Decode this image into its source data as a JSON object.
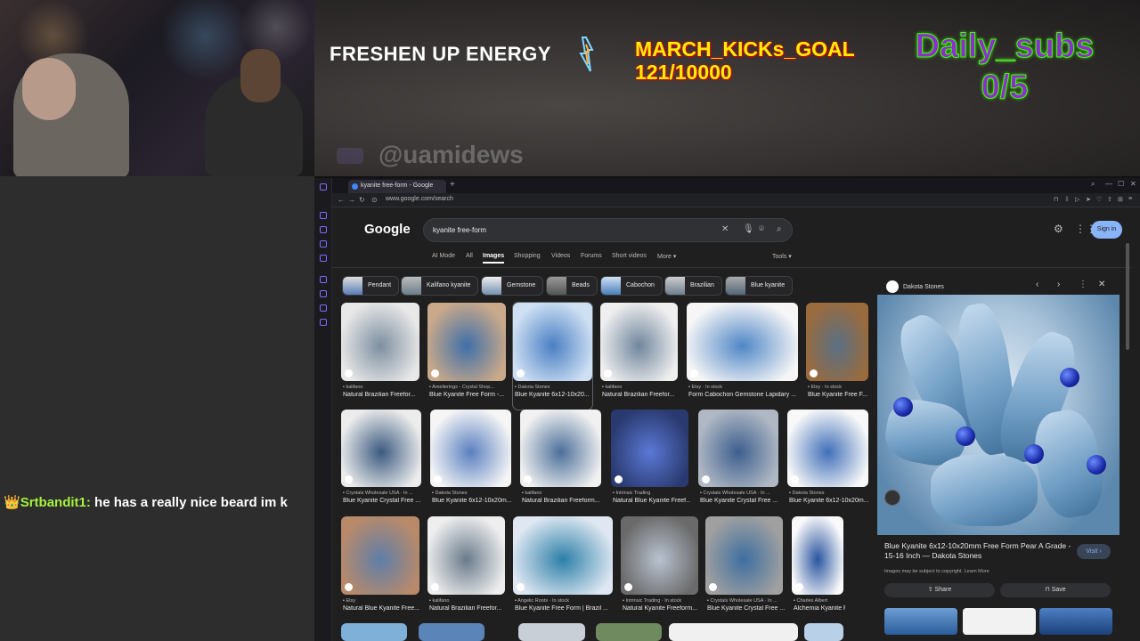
{
  "overlay": {
    "freshen_text": "FRESHEN UP ENERGY",
    "goal_title": "MARCH_KICKs_GOAL",
    "goal_value": "121/10000",
    "daily_title": "Daily_subs",
    "daily_value": "0/5",
    "handle": "@uamidews"
  },
  "chat": {
    "crown": "👑",
    "user": "Srtbandit1:",
    "message": "he has a really nice beard im k"
  },
  "browser": {
    "tab_title": "kyanite free-form - Google",
    "url": "www.google.com/search"
  },
  "google": {
    "logo": "Google",
    "query": "kyanite free-form",
    "signin": "Sign in",
    "tabs": [
      "AI Mode",
      "All",
      "Images",
      "Shopping",
      "Videos",
      "Forums",
      "Short videos",
      "More ▾"
    ],
    "tools": "Tools ▾",
    "chips": [
      "Pendant",
      "Kalifano kyanite",
      "Gemstone",
      "Beads",
      "Cabochon",
      "Brazilian",
      "Blue kyanite"
    ]
  },
  "results": [
    {
      "src": "kalifano",
      "title": "Natural Brazilian Freefor..."
    },
    {
      "src": "Amelierings - Crystal Shop...",
      "title": "Blue Kyanite Free Form -..."
    },
    {
      "src": "Dakota Stones",
      "title": "Blue Kyanite 6x12-10x20..."
    },
    {
      "src": "kalifano",
      "title": "Natural Brazilian Freefor..."
    },
    {
      "src": "Etsy · In stock",
      "title": "Form Cabochon Gemstone Lapidary ..."
    },
    {
      "src": "Etsy · In stock",
      "title": "Blue Kyanite Free F..."
    },
    {
      "src": "Crystals Wholesale USA · In ...",
      "title": "Blue Kyanite Crystal Free ..."
    },
    {
      "src": "Dakota Stones",
      "title": "Blue Kyanite 6x12-10x20m..."
    },
    {
      "src": "kalifano",
      "title": "Natural Brazilian Freeform..."
    },
    {
      "src": "Intrinsic Trading",
      "title": "Natural Blue Kyanite Freef..."
    },
    {
      "src": "Crystals Wholesale USA · In ...",
      "title": "Blue Kyanite Crystal Free ..."
    },
    {
      "src": "Dakota Stones",
      "title": "Blue Kyanite 6x12-10x20m..."
    },
    {
      "src": "Etsy",
      "title": "Natural Blue Kyanite Free..."
    },
    {
      "src": "kalifano",
      "title": "Natural Brazilian Freefor..."
    },
    {
      "src": "Angelic Roots · In stock",
      "title": "Blue Kyanite Free Form | Brazil ..."
    },
    {
      "src": "Intrinsic Trading · In stock",
      "title": "Natural Kyanite Freeform..."
    },
    {
      "src": "Crystals Wholesale USA · In ...",
      "title": "Blue Kyanite Crystal Free ..."
    },
    {
      "src": "Charles Albert",
      "title": "Alchemia Kyanite Freefor..."
    }
  ],
  "preview": {
    "source": "Dakota Stones",
    "title": "Blue Kyanite 6x12-10x20mm Free Form Pear A Grade - 15-16 Inch — Dakota Stones",
    "visit": "Visit ›",
    "copyright": "Images may be subject to copyright. Learn More",
    "share": "⇪ Share",
    "save": "⊓ Save"
  }
}
